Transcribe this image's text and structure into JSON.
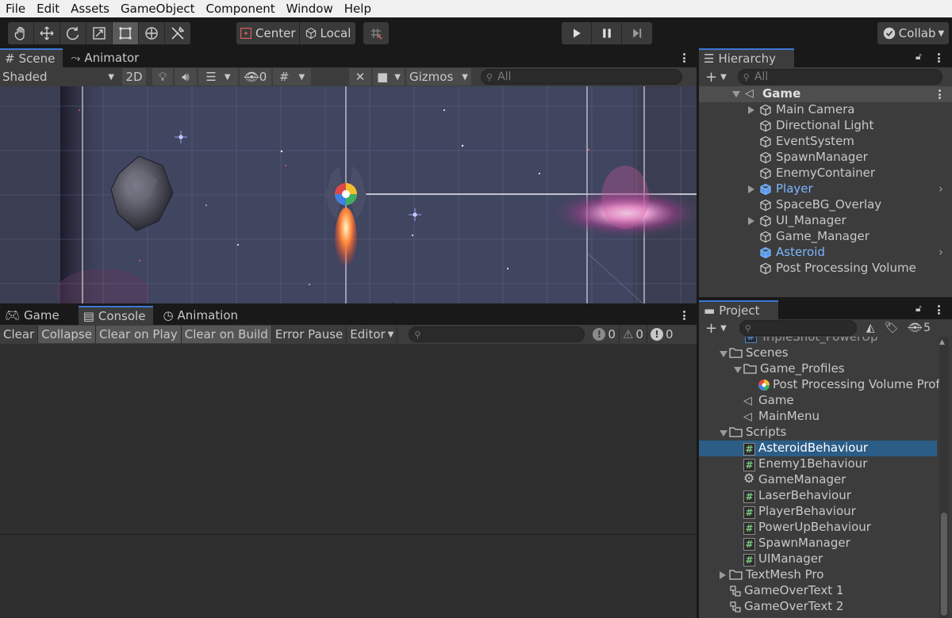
{
  "menu": [
    "File",
    "Edit",
    "Assets",
    "GameObject",
    "Component",
    "Window",
    "Help"
  ],
  "toolbar": {
    "center_label": "Center",
    "local_label": "Local",
    "collab_label": "Collab"
  },
  "scene_tabs": {
    "scene": "Scene",
    "animator": "Animator"
  },
  "scene_toolbar": {
    "shading": "Shaded",
    "mode_2d": "2D",
    "hidden_count": "0",
    "gizmos": "Gizmos",
    "search_placeholder": "All"
  },
  "bottom_tabs": {
    "game": "Game",
    "console": "Console",
    "animation": "Animation"
  },
  "console_toolbar": {
    "clear": "Clear",
    "collapse": "Collapse",
    "clear_on_play": "Clear on Play",
    "clear_on_build": "Clear on Build",
    "error_pause": "Error Pause",
    "editor": "Editor",
    "log_count": "0",
    "warn_count": "0",
    "error_count": "0"
  },
  "hierarchy": {
    "title": "Hierarchy",
    "search_placeholder": "All",
    "scene_name": "Game",
    "items": [
      {
        "label": "Main Camera",
        "expandable": true,
        "prefab": false
      },
      {
        "label": "Directional Light",
        "expandable": false,
        "prefab": false
      },
      {
        "label": "EventSystem",
        "expandable": false,
        "prefab": false
      },
      {
        "label": "SpawnManager",
        "expandable": false,
        "prefab": false
      },
      {
        "label": "EnemyContainer",
        "expandable": false,
        "prefab": false
      },
      {
        "label": "Player",
        "expandable": true,
        "prefab": true
      },
      {
        "label": "SpaceBG_Overlay",
        "expandable": false,
        "prefab": false
      },
      {
        "label": "UI_Manager",
        "expandable": true,
        "prefab": false
      },
      {
        "label": "Game_Manager",
        "expandable": false,
        "prefab": false
      },
      {
        "label": "Asteroid",
        "expandable": false,
        "prefab": true
      },
      {
        "label": "Post Processing Volume",
        "expandable": false,
        "prefab": false
      }
    ]
  },
  "project": {
    "title": "Project",
    "hidden_count": "5",
    "clipped_item": "TripleShot_PowerUp",
    "items": [
      {
        "label": "Scenes",
        "type": "folder-open"
      },
      {
        "label": "Game_Profiles",
        "type": "folder-open"
      },
      {
        "label": "Post Processing Volume Prof",
        "type": "profile"
      },
      {
        "label": "Game",
        "type": "scene"
      },
      {
        "label": "MainMenu",
        "type": "scene"
      },
      {
        "label": "Scripts",
        "type": "folder-open"
      },
      {
        "label": "AsteroidBehaviour",
        "type": "script",
        "selected": true
      },
      {
        "label": "Enemy1Behaviour",
        "type": "script"
      },
      {
        "label": "GameManager",
        "type": "gear"
      },
      {
        "label": "LaserBehaviour",
        "type": "script"
      },
      {
        "label": "PlayerBehaviour",
        "type": "script"
      },
      {
        "label": "PowerUpBehaviour",
        "type": "script"
      },
      {
        "label": "SpawnManager",
        "type": "script"
      },
      {
        "label": "UIManager",
        "type": "script"
      },
      {
        "label": "TextMesh Pro",
        "type": "folder-closed"
      },
      {
        "label": "GameOverText 1",
        "type": "prefab-variant"
      },
      {
        "label": "GameOverText 2",
        "type": "prefab-variant"
      }
    ]
  },
  "colors": {
    "accent": "#3a78d6",
    "selected_row": "#2c5d87",
    "prefab_text": "#7cb6ff",
    "script_hash": "#7fc97f"
  }
}
